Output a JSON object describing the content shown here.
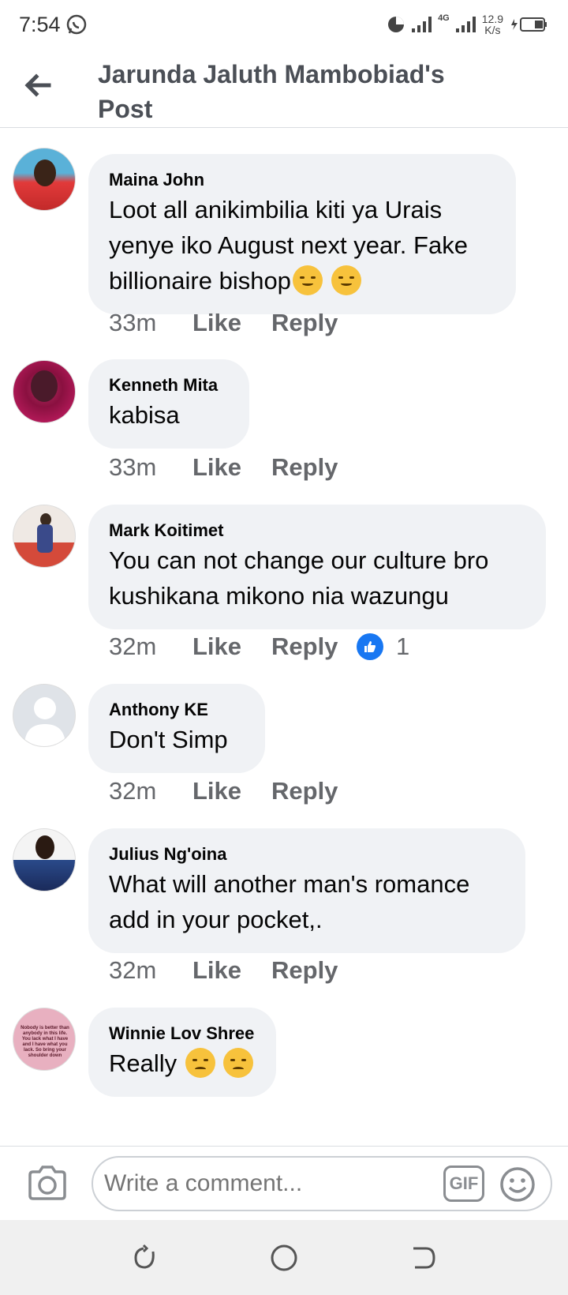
{
  "status_bar": {
    "time": "7:54",
    "net_speed_value": "12.9",
    "net_speed_unit": "K/s",
    "network_type": "4G"
  },
  "header": {
    "title": "Jarunda Jaluth Mambobiad's Post",
    "back_icon": "arrow-left-icon"
  },
  "comments": [
    {
      "author": "Maina John",
      "text": "Loot all anikimbilia kiti ya Urais yenye iko August next year. Fake billionaire bishop",
      "emoji_count": 2,
      "emoji": "pensive-face",
      "time": "33m",
      "like": "Like",
      "reply": "Reply"
    },
    {
      "author": "Kenneth Mita",
      "text": "kabisa",
      "time": "33m",
      "like": "Like",
      "reply": "Reply"
    },
    {
      "author": "Mark Koitimet",
      "text": "You can not change our culture bro kushikana mikono nia wazungu",
      "time": "32m",
      "like": "Like",
      "reply": "Reply",
      "reactions": "1"
    },
    {
      "author": "Anthony KE",
      "text": "Don't Simp",
      "time": "32m",
      "like": "Like",
      "reply": "Reply"
    },
    {
      "author": "Julius Ng'oina",
      "text": "What will another man's romance add in your pocket,.",
      "time": "32m",
      "like": "Like",
      "reply": "Reply"
    },
    {
      "author": "Winnie Lov Shree",
      "text": "Really",
      "emoji_count": 2,
      "emoji": "frowning-face",
      "avatar_text": "Nobody is better than anybody in this life. You lack what I have and I have what you lack. So bring your shoulder down"
    }
  ],
  "composer": {
    "placeholder": "Write a comment...",
    "gif_label": "GIF"
  },
  "colors": {
    "bubble": "#f0f2f5",
    "meta": "#65676b",
    "header_title": "#4b4f56",
    "like_blue": "#1877f2"
  }
}
